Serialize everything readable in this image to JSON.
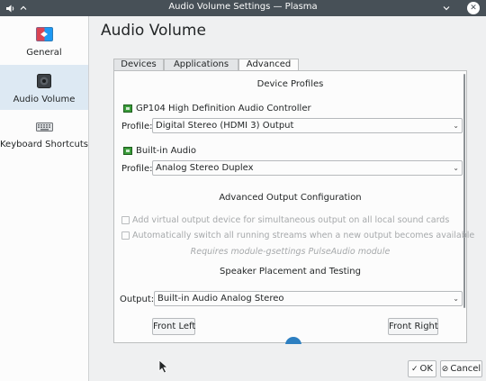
{
  "window": {
    "title": "Audio Volume Settings — Plasma",
    "icon": "speaker-icon",
    "keep_above_icon": "chevron-up-icon",
    "minimize_icon": "chevron-down-icon",
    "close_icon": "close-icon"
  },
  "sidebar": {
    "items": [
      {
        "label": "General",
        "icon": "general-icon"
      },
      {
        "label": "Audio Volume",
        "icon": "speaker-icon"
      },
      {
        "label": "Keyboard Shortcuts",
        "icon": "keyboard-icon"
      }
    ],
    "active_index": 1
  },
  "main": {
    "title": "Audio Volume",
    "tabs": [
      {
        "label": "Devices"
      },
      {
        "label": "Applications"
      },
      {
        "label": "Advanced"
      }
    ],
    "active_tab": 2
  },
  "device_profiles": {
    "title": "Device Profiles",
    "cards": [
      {
        "name": "GP104 High Definition Audio Controller",
        "profile_label": "Profile:",
        "profile_value": "Digital Stereo (HDMI 3) Output"
      },
      {
        "name": "Built-in Audio",
        "profile_label": "Profile:",
        "profile_value": "Analog Stereo Duplex"
      }
    ]
  },
  "advanced_output": {
    "title": "Advanced Output Configuration",
    "options": [
      {
        "label": "Add virtual output device for simultaneous output on all local sound cards",
        "checked": false,
        "enabled": false
      },
      {
        "label": "Automatically switch all running streams when a new output becomes available",
        "checked": false,
        "enabled": false
      }
    ],
    "note": "Requires module-gsettings PulseAudio module"
  },
  "speaker_testing": {
    "title": "Speaker Placement and Testing",
    "output_label": "Output:",
    "output_value": "Built-in Audio Analog Stereo",
    "front_left": "Front Left",
    "front_right": "Front Right"
  },
  "footer": {
    "ok_label": "OK",
    "cancel_label": "Cancel"
  },
  "colors": {
    "titlebar": "#475057",
    "selection": "#dde9f3",
    "accent": "#2d7fc1"
  }
}
